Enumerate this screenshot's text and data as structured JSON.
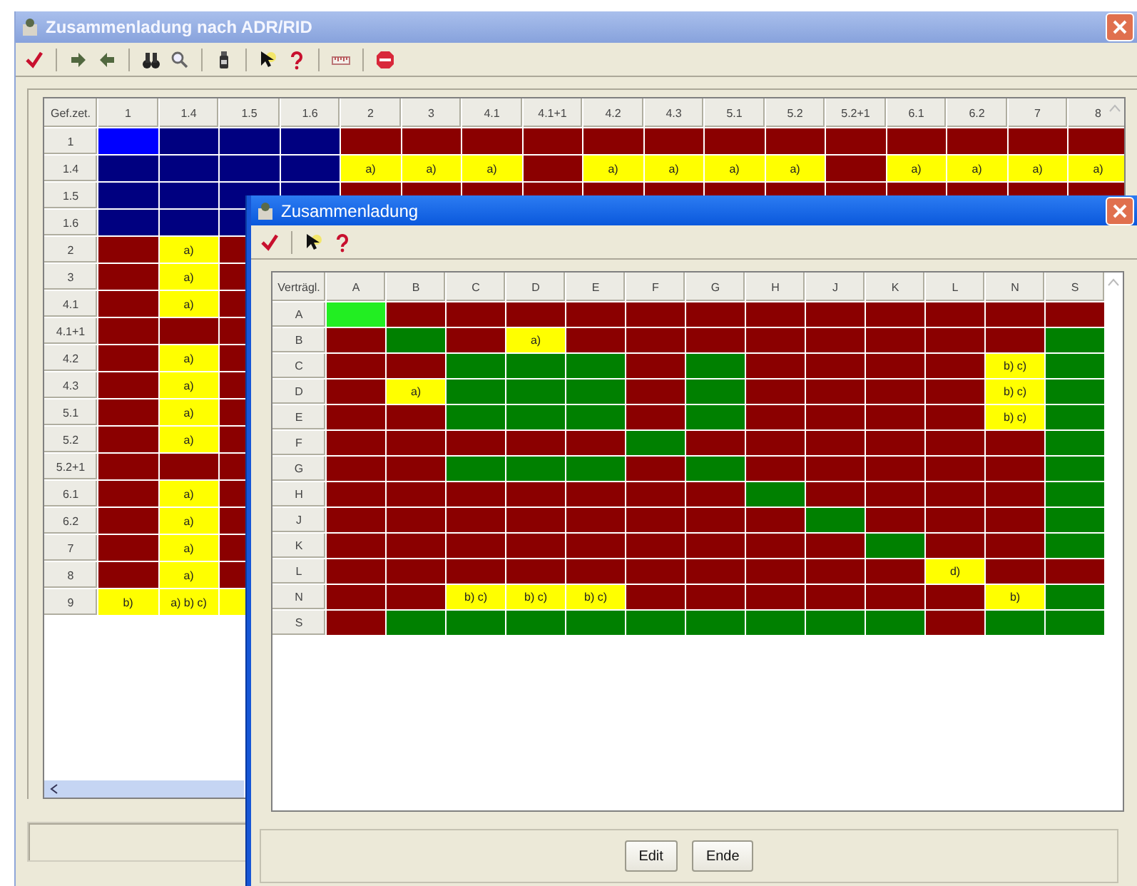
{
  "main_window": {
    "title": "Zusammenladung nach ADR/RID",
    "grid": {
      "corner": "Gef.zet.",
      "columns": [
        "1",
        "1.4",
        "1.5",
        "1.6",
        "2",
        "3",
        "4.1",
        "4.1+1",
        "4.2",
        "4.3",
        "5.1",
        "5.2",
        "5.2+1",
        "6.1",
        "6.2",
        "7",
        "8"
      ],
      "rows": [
        {
          "label": "1",
          "cells": [
            {
              "color": "#0000ff"
            },
            {
              "color": "#000080"
            },
            {
              "color": "#000080"
            },
            {
              "color": "#000080"
            },
            {
              "color": "#8b0000"
            },
            {
              "color": "#8b0000"
            },
            {
              "color": "#8b0000"
            },
            {
              "color": "#8b0000"
            },
            {
              "color": "#8b0000"
            },
            {
              "color": "#8b0000"
            },
            {
              "color": "#8b0000"
            },
            {
              "color": "#8b0000"
            },
            {
              "color": "#8b0000"
            },
            {
              "color": "#8b0000"
            },
            {
              "color": "#8b0000"
            },
            {
              "color": "#8b0000"
            },
            {
              "color": "#8b0000"
            }
          ]
        },
        {
          "label": "1.4",
          "cells": [
            {
              "color": "#000080"
            },
            {
              "color": "#000080"
            },
            {
              "color": "#000080"
            },
            {
              "color": "#000080"
            },
            {
              "color": "#ffff00",
              "text": "a)"
            },
            {
              "color": "#ffff00",
              "text": "a)"
            },
            {
              "color": "#ffff00",
              "text": "a)"
            },
            {
              "color": "#8b0000"
            },
            {
              "color": "#ffff00",
              "text": "a)"
            },
            {
              "color": "#ffff00",
              "text": "a)"
            },
            {
              "color": "#ffff00",
              "text": "a)"
            },
            {
              "color": "#ffff00",
              "text": "a)"
            },
            {
              "color": "#8b0000"
            },
            {
              "color": "#ffff00",
              "text": "a)"
            },
            {
              "color": "#ffff00",
              "text": "a)"
            },
            {
              "color": "#ffff00",
              "text": "a)"
            },
            {
              "color": "#ffff00",
              "text": "a)"
            }
          ]
        },
        {
          "label": "1.5",
          "cells": [
            {
              "color": "#000080"
            },
            {
              "color": "#000080"
            },
            {
              "color": "#000080"
            },
            {
              "color": "#000080"
            },
            {
              "color": "#8b0000"
            },
            {
              "color": "#8b0000"
            },
            {
              "color": "#8b0000"
            },
            {
              "color": "#8b0000"
            },
            {
              "color": "#8b0000"
            },
            {
              "color": "#8b0000"
            },
            {
              "color": "#8b0000"
            },
            {
              "color": "#8b0000"
            },
            {
              "color": "#8b0000"
            },
            {
              "color": "#8b0000"
            },
            {
              "color": "#8b0000"
            },
            {
              "color": "#8b0000"
            },
            {
              "color": "#8b0000"
            }
          ]
        },
        {
          "label": "1.6",
          "cells": [
            {
              "color": "#000080"
            },
            {
              "color": "#000080"
            },
            {
              "color": "#000080"
            }
          ]
        },
        {
          "label": "2",
          "cells": [
            {
              "color": "#8b0000"
            },
            {
              "color": "#ffff00",
              "text": "a)"
            },
            {
              "color": "#8b0000"
            }
          ]
        },
        {
          "label": "3",
          "cells": [
            {
              "color": "#8b0000"
            },
            {
              "color": "#ffff00",
              "text": "a)"
            },
            {
              "color": "#8b0000"
            }
          ]
        },
        {
          "label": "4.1",
          "cells": [
            {
              "color": "#8b0000"
            },
            {
              "color": "#ffff00",
              "text": "a)"
            },
            {
              "color": "#8b0000"
            }
          ]
        },
        {
          "label": "4.1+1",
          "cells": [
            {
              "color": "#8b0000"
            },
            {
              "color": "#8b0000"
            },
            {
              "color": "#8b0000"
            }
          ]
        },
        {
          "label": "4.2",
          "cells": [
            {
              "color": "#8b0000"
            },
            {
              "color": "#ffff00",
              "text": "a)"
            },
            {
              "color": "#8b0000"
            }
          ]
        },
        {
          "label": "4.3",
          "cells": [
            {
              "color": "#8b0000"
            },
            {
              "color": "#ffff00",
              "text": "a)"
            },
            {
              "color": "#8b0000"
            }
          ]
        },
        {
          "label": "5.1",
          "cells": [
            {
              "color": "#8b0000"
            },
            {
              "color": "#ffff00",
              "text": "a)"
            },
            {
              "color": "#8b0000"
            }
          ]
        },
        {
          "label": "5.2",
          "cells": [
            {
              "color": "#8b0000"
            },
            {
              "color": "#ffff00",
              "text": "a)"
            },
            {
              "color": "#8b0000"
            }
          ]
        },
        {
          "label": "5.2+1",
          "cells": [
            {
              "color": "#8b0000"
            },
            {
              "color": "#8b0000"
            },
            {
              "color": "#8b0000"
            }
          ]
        },
        {
          "label": "6.1",
          "cells": [
            {
              "color": "#8b0000"
            },
            {
              "color": "#ffff00",
              "text": "a)"
            },
            {
              "color": "#8b0000"
            }
          ]
        },
        {
          "label": "6.2",
          "cells": [
            {
              "color": "#8b0000"
            },
            {
              "color": "#ffff00",
              "text": "a)"
            },
            {
              "color": "#8b0000"
            }
          ]
        },
        {
          "label": "7",
          "cells": [
            {
              "color": "#8b0000"
            },
            {
              "color": "#ffff00",
              "text": "a)"
            },
            {
              "color": "#8b0000"
            }
          ]
        },
        {
          "label": "8",
          "cells": [
            {
              "color": "#8b0000"
            },
            {
              "color": "#ffff00",
              "text": "a)"
            },
            {
              "color": "#8b0000"
            }
          ]
        },
        {
          "label": "9",
          "cells": [
            {
              "color": "#ffff00",
              "text": "b)"
            },
            {
              "color": "#ffff00",
              "text": "a) b) c)"
            },
            {
              "color": "#ffff00"
            }
          ]
        }
      ]
    }
  },
  "dialog": {
    "title": "Zusammenladung",
    "grid": {
      "corner": "Verträgl.",
      "columns": [
        "A",
        "B",
        "C",
        "D",
        "E",
        "F",
        "G",
        "H",
        "J",
        "K",
        "L",
        "N",
        "S"
      ],
      "rows": [
        {
          "label": "A",
          "cells": [
            {
              "color": "#22ee22"
            },
            {
              "color": "#8b0000"
            },
            {
              "color": "#8b0000"
            },
            {
              "color": "#8b0000"
            },
            {
              "color": "#8b0000"
            },
            {
              "color": "#8b0000"
            },
            {
              "color": "#8b0000"
            },
            {
              "color": "#8b0000"
            },
            {
              "color": "#8b0000"
            },
            {
              "color": "#8b0000"
            },
            {
              "color": "#8b0000"
            },
            {
              "color": "#8b0000"
            },
            {
              "color": "#8b0000"
            }
          ]
        },
        {
          "label": "B",
          "cells": [
            {
              "color": "#8b0000"
            },
            {
              "color": "#008000"
            },
            {
              "color": "#8b0000"
            },
            {
              "color": "#ffff00",
              "text": "a)"
            },
            {
              "color": "#8b0000"
            },
            {
              "color": "#8b0000"
            },
            {
              "color": "#8b0000"
            },
            {
              "color": "#8b0000"
            },
            {
              "color": "#8b0000"
            },
            {
              "color": "#8b0000"
            },
            {
              "color": "#8b0000"
            },
            {
              "color": "#8b0000"
            },
            {
              "color": "#008000"
            }
          ]
        },
        {
          "label": "C",
          "cells": [
            {
              "color": "#8b0000"
            },
            {
              "color": "#8b0000"
            },
            {
              "color": "#008000"
            },
            {
              "color": "#008000"
            },
            {
              "color": "#008000"
            },
            {
              "color": "#8b0000"
            },
            {
              "color": "#008000"
            },
            {
              "color": "#8b0000"
            },
            {
              "color": "#8b0000"
            },
            {
              "color": "#8b0000"
            },
            {
              "color": "#8b0000"
            },
            {
              "color": "#ffff00",
              "text": "b) c)"
            },
            {
              "color": "#008000"
            }
          ]
        },
        {
          "label": "D",
          "cells": [
            {
              "color": "#8b0000"
            },
            {
              "color": "#ffff00",
              "text": "a)"
            },
            {
              "color": "#008000"
            },
            {
              "color": "#008000"
            },
            {
              "color": "#008000"
            },
            {
              "color": "#8b0000"
            },
            {
              "color": "#008000"
            },
            {
              "color": "#8b0000"
            },
            {
              "color": "#8b0000"
            },
            {
              "color": "#8b0000"
            },
            {
              "color": "#8b0000"
            },
            {
              "color": "#ffff00",
              "text": "b) c)"
            },
            {
              "color": "#008000"
            }
          ]
        },
        {
          "label": "E",
          "cells": [
            {
              "color": "#8b0000"
            },
            {
              "color": "#8b0000"
            },
            {
              "color": "#008000"
            },
            {
              "color": "#008000"
            },
            {
              "color": "#008000"
            },
            {
              "color": "#8b0000"
            },
            {
              "color": "#008000"
            },
            {
              "color": "#8b0000"
            },
            {
              "color": "#8b0000"
            },
            {
              "color": "#8b0000"
            },
            {
              "color": "#8b0000"
            },
            {
              "color": "#ffff00",
              "text": "b) c)"
            },
            {
              "color": "#008000"
            }
          ]
        },
        {
          "label": "F",
          "cells": [
            {
              "color": "#8b0000"
            },
            {
              "color": "#8b0000"
            },
            {
              "color": "#8b0000"
            },
            {
              "color": "#8b0000"
            },
            {
              "color": "#8b0000"
            },
            {
              "color": "#008000"
            },
            {
              "color": "#8b0000"
            },
            {
              "color": "#8b0000"
            },
            {
              "color": "#8b0000"
            },
            {
              "color": "#8b0000"
            },
            {
              "color": "#8b0000"
            },
            {
              "color": "#8b0000"
            },
            {
              "color": "#008000"
            }
          ]
        },
        {
          "label": "G",
          "cells": [
            {
              "color": "#8b0000"
            },
            {
              "color": "#8b0000"
            },
            {
              "color": "#008000"
            },
            {
              "color": "#008000"
            },
            {
              "color": "#008000"
            },
            {
              "color": "#8b0000"
            },
            {
              "color": "#008000"
            },
            {
              "color": "#8b0000"
            },
            {
              "color": "#8b0000"
            },
            {
              "color": "#8b0000"
            },
            {
              "color": "#8b0000"
            },
            {
              "color": "#8b0000"
            },
            {
              "color": "#008000"
            }
          ]
        },
        {
          "label": "H",
          "cells": [
            {
              "color": "#8b0000"
            },
            {
              "color": "#8b0000"
            },
            {
              "color": "#8b0000"
            },
            {
              "color": "#8b0000"
            },
            {
              "color": "#8b0000"
            },
            {
              "color": "#8b0000"
            },
            {
              "color": "#8b0000"
            },
            {
              "color": "#008000"
            },
            {
              "color": "#8b0000"
            },
            {
              "color": "#8b0000"
            },
            {
              "color": "#8b0000"
            },
            {
              "color": "#8b0000"
            },
            {
              "color": "#008000"
            }
          ]
        },
        {
          "label": "J",
          "cells": [
            {
              "color": "#8b0000"
            },
            {
              "color": "#8b0000"
            },
            {
              "color": "#8b0000"
            },
            {
              "color": "#8b0000"
            },
            {
              "color": "#8b0000"
            },
            {
              "color": "#8b0000"
            },
            {
              "color": "#8b0000"
            },
            {
              "color": "#8b0000"
            },
            {
              "color": "#008000"
            },
            {
              "color": "#8b0000"
            },
            {
              "color": "#8b0000"
            },
            {
              "color": "#8b0000"
            },
            {
              "color": "#008000"
            }
          ]
        },
        {
          "label": "K",
          "cells": [
            {
              "color": "#8b0000"
            },
            {
              "color": "#8b0000"
            },
            {
              "color": "#8b0000"
            },
            {
              "color": "#8b0000"
            },
            {
              "color": "#8b0000"
            },
            {
              "color": "#8b0000"
            },
            {
              "color": "#8b0000"
            },
            {
              "color": "#8b0000"
            },
            {
              "color": "#8b0000"
            },
            {
              "color": "#008000"
            },
            {
              "color": "#8b0000"
            },
            {
              "color": "#8b0000"
            },
            {
              "color": "#008000"
            }
          ]
        },
        {
          "label": "L",
          "cells": [
            {
              "color": "#8b0000"
            },
            {
              "color": "#8b0000"
            },
            {
              "color": "#8b0000"
            },
            {
              "color": "#8b0000"
            },
            {
              "color": "#8b0000"
            },
            {
              "color": "#8b0000"
            },
            {
              "color": "#8b0000"
            },
            {
              "color": "#8b0000"
            },
            {
              "color": "#8b0000"
            },
            {
              "color": "#8b0000"
            },
            {
              "color": "#ffff00",
              "text": "d)"
            },
            {
              "color": "#8b0000"
            },
            {
              "color": "#8b0000"
            }
          ]
        },
        {
          "label": "N",
          "cells": [
            {
              "color": "#8b0000"
            },
            {
              "color": "#8b0000"
            },
            {
              "color": "#ffff00",
              "text": "b) c)"
            },
            {
              "color": "#ffff00",
              "text": "b) c)"
            },
            {
              "color": "#ffff00",
              "text": "b) c)"
            },
            {
              "color": "#8b0000"
            },
            {
              "color": "#8b0000"
            },
            {
              "color": "#8b0000"
            },
            {
              "color": "#8b0000"
            },
            {
              "color": "#8b0000"
            },
            {
              "color": "#8b0000"
            },
            {
              "color": "#ffff00",
              "text": "b)"
            },
            {
              "color": "#008000"
            }
          ]
        },
        {
          "label": "S",
          "cells": [
            {
              "color": "#8b0000"
            },
            {
              "color": "#008000"
            },
            {
              "color": "#008000"
            },
            {
              "color": "#008000"
            },
            {
              "color": "#008000"
            },
            {
              "color": "#008000"
            },
            {
              "color": "#008000"
            },
            {
              "color": "#008000"
            },
            {
              "color": "#008000"
            },
            {
              "color": "#008000"
            },
            {
              "color": "#8b0000"
            },
            {
              "color": "#008000"
            },
            {
              "color": "#008000"
            }
          ]
        }
      ]
    },
    "buttons": [
      "Edit",
      "Ende"
    ]
  }
}
